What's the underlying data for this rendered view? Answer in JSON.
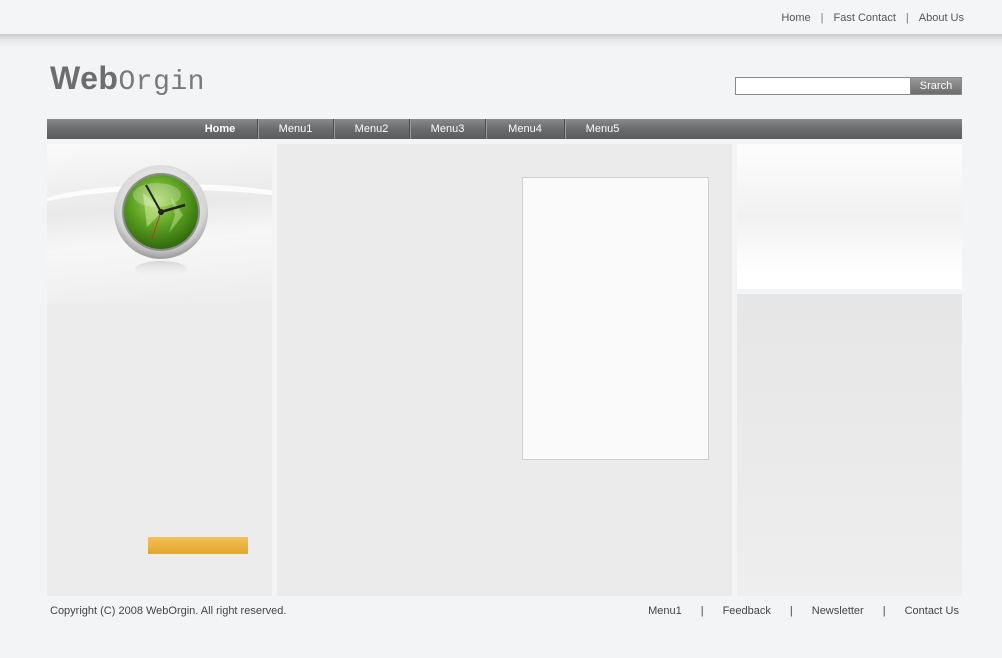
{
  "top_links": {
    "home": "Home",
    "fast_contact": "Fast Contact",
    "about_us": "About Us",
    "separator": "|"
  },
  "logo": {
    "bold_part": "Web",
    "light_part": "Orgin"
  },
  "search": {
    "value": "",
    "button_label": "Srarch"
  },
  "nav": {
    "items": [
      "Home",
      "Menu1",
      "Menu2",
      "Menu3",
      "Menu4",
      "Menu5"
    ],
    "active_index": 0
  },
  "footer": {
    "copyright": "Copyright (C) 2008 WebOrgin. All right reserved.",
    "links": [
      "Menu1",
      "Feedback",
      "Newsletter",
      "Contact Us"
    ],
    "separator": "|"
  },
  "colors": {
    "background": "#f3f4f6",
    "nav_bar": "#6b6b6b",
    "accent_orange": "#e8ae35",
    "clock_green": "#5aa020"
  }
}
